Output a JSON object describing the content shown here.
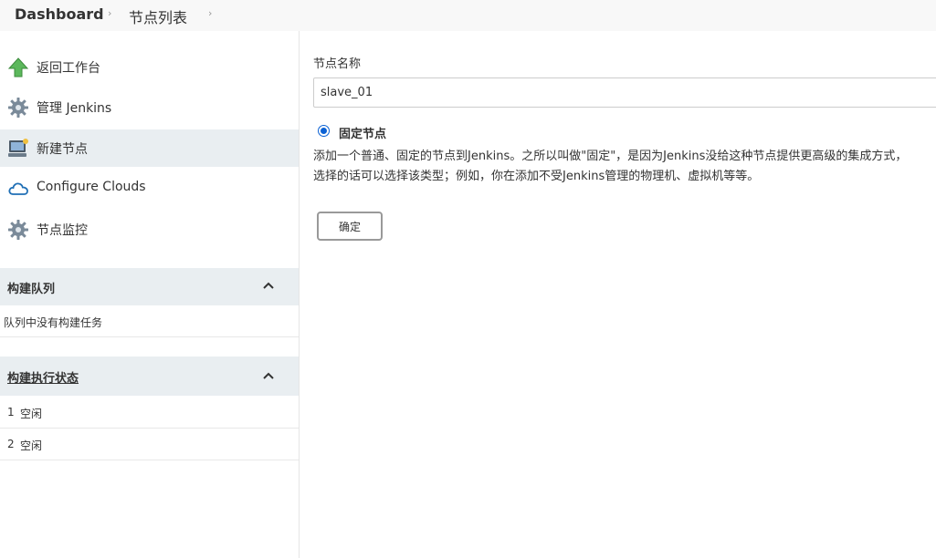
{
  "breadcrumb": {
    "items": [
      "Dashboard",
      "节点列表"
    ]
  },
  "sidebar": {
    "tasks": [
      {
        "label": "返回工作台",
        "icon": "up-arrow-icon"
      },
      {
        "label": "管理 Jenkins",
        "icon": "gear-icon"
      },
      {
        "label": "新建节点",
        "icon": "computer-icon",
        "active": true
      },
      {
        "label": "Configure Clouds",
        "icon": "cloud-icon"
      },
      {
        "label": "节点监控",
        "icon": "gear-icon"
      }
    ],
    "build_queue": {
      "title": "构建队列",
      "empty_text": "队列中没有构建任务"
    },
    "executors": {
      "title": "构建执行状态",
      "rows": [
        {
          "number": "1",
          "status": "空闲"
        },
        {
          "number": "2",
          "status": "空闲"
        }
      ]
    }
  },
  "main": {
    "name_label": "节点名称",
    "name_value": "slave_01",
    "radio_label": "固定节点",
    "description_line1": "添加一个普通、固定的节点到Jenkins。之所以叫做\"固定\"，是因为Jenkins没给这种节点提供更高级的集成方式，",
    "description_line2": "选择的话可以选择该类型；例如，你在添加不受Jenkins管理的物理机、虚拟机等等。",
    "ok_label": "确定"
  },
  "colors": {
    "accent": "#0b61d4",
    "active_bg": "#e9eef1",
    "arrow_green": "#5cb85c"
  }
}
